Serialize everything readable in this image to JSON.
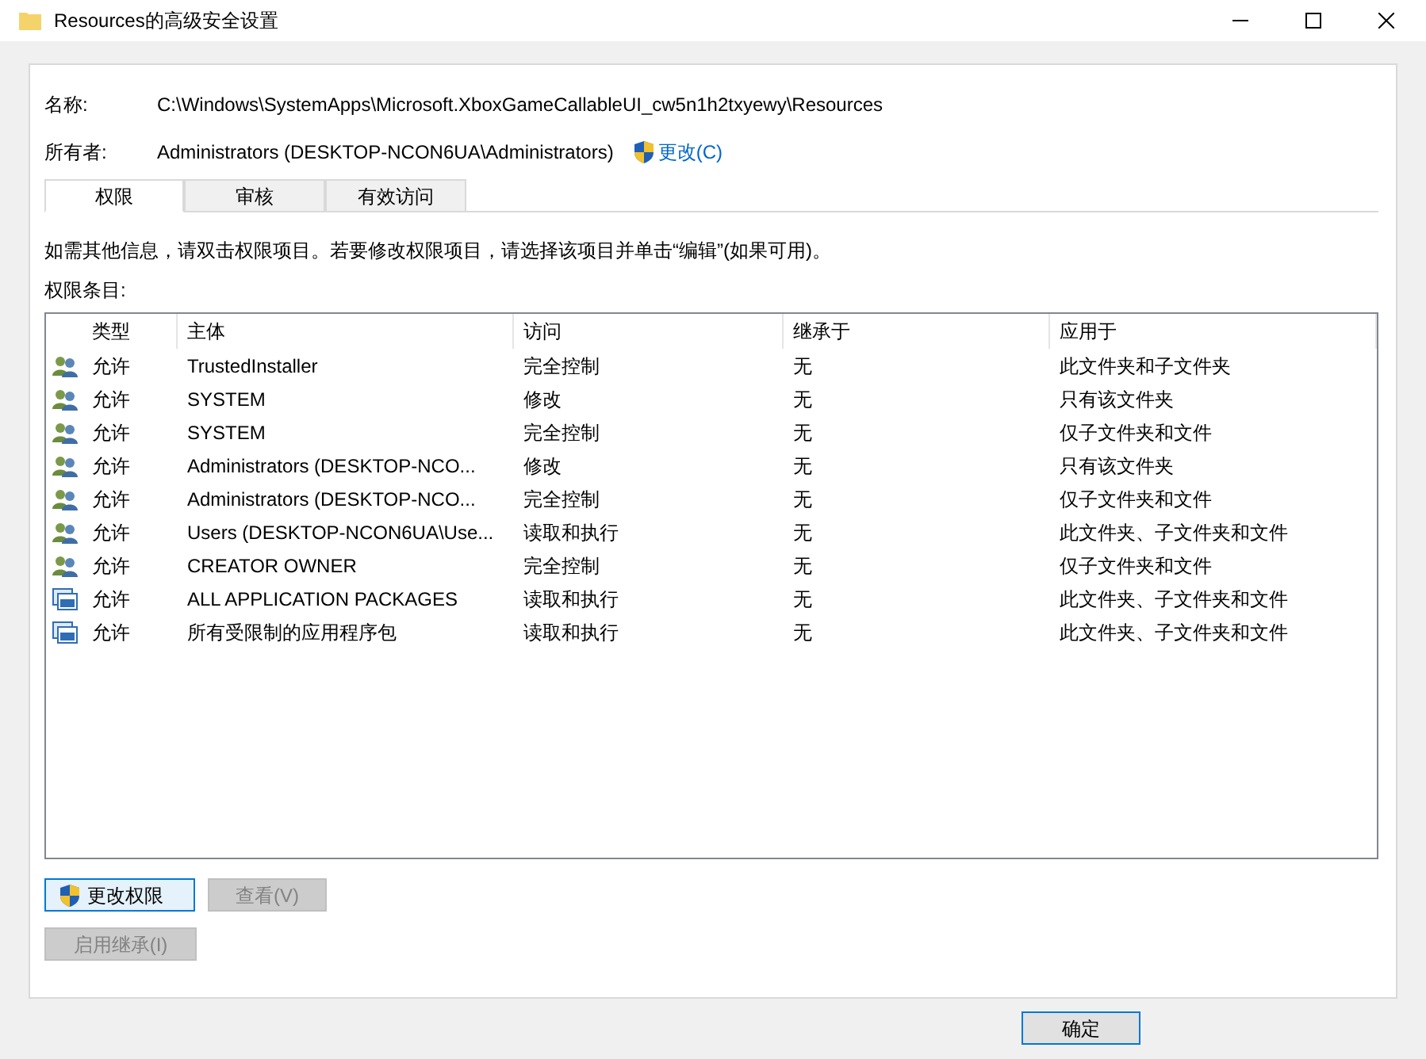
{
  "window": {
    "title": "Resources的高级安全设置"
  },
  "name": {
    "label": "名称:",
    "value": "C:\\Windows\\SystemApps\\Microsoft.XboxGameCallableUI_cw5n1h2txyewy\\Resources"
  },
  "owner": {
    "label": "所有者:",
    "value": "Administrators (DESKTOP-NCON6UA\\Administrators)",
    "link": "更改(C)"
  },
  "tabs": [
    {
      "label": "权限",
      "selected": true
    },
    {
      "label": "审核",
      "selected": false
    },
    {
      "label": "有效访问",
      "selected": false
    }
  ],
  "info": "如需其他信息，请双击权限项目。若要修改权限项目，请选择该项目并单击“编辑”(如果可用)。",
  "entries_label": "权限条目:",
  "table": {
    "columns": [
      "类型",
      "主体",
      "访问",
      "继承于",
      "应用于"
    ],
    "rows": [
      {
        "kind": "user",
        "cells": [
          "允许",
          "TrustedInstaller",
          "完全控制",
          "无",
          "此文件夹和子文件夹"
        ]
      },
      {
        "kind": "user",
        "cells": [
          "允许",
          "SYSTEM",
          "修改",
          "无",
          "只有该文件夹"
        ]
      },
      {
        "kind": "user",
        "cells": [
          "允许",
          "SYSTEM",
          "完全控制",
          "无",
          "仅子文件夹和文件"
        ]
      },
      {
        "kind": "user",
        "cells": [
          "允许",
          "Administrators (DESKTOP-NCO...",
          "修改",
          "无",
          "只有该文件夹"
        ]
      },
      {
        "kind": "user",
        "cells": [
          "允许",
          "Administrators (DESKTOP-NCO...",
          "完全控制",
          "无",
          "仅子文件夹和文件"
        ]
      },
      {
        "kind": "user",
        "cells": [
          "允许",
          "Users (DESKTOP-NCON6UA\\Use...",
          "读取和执行",
          "无",
          "此文件夹、子文件夹和文件"
        ]
      },
      {
        "kind": "user",
        "cells": [
          "允许",
          "CREATOR OWNER",
          "完全控制",
          "无",
          "仅子文件夹和文件"
        ]
      },
      {
        "kind": "package",
        "cells": [
          "允许",
          "ALL APPLICATION PACKAGES",
          "读取和执行",
          "无",
          "此文件夹、子文件夹和文件"
        ]
      },
      {
        "kind": "package",
        "cells": [
          "允许",
          "所有受限制的应用程序包",
          "读取和执行",
          "无",
          "此文件夹、子文件夹和文件"
        ]
      }
    ]
  },
  "buttons": [
    {
      "label": "更改权限",
      "shield": true,
      "disabled": false
    },
    {
      "label": "查看(V)",
      "shield": false,
      "disabled": true
    }
  ],
  "inherit_button": {
    "label": "启用继承(I)",
    "disabled": true
  },
  "ok_button": {
    "label": "确定"
  }
}
